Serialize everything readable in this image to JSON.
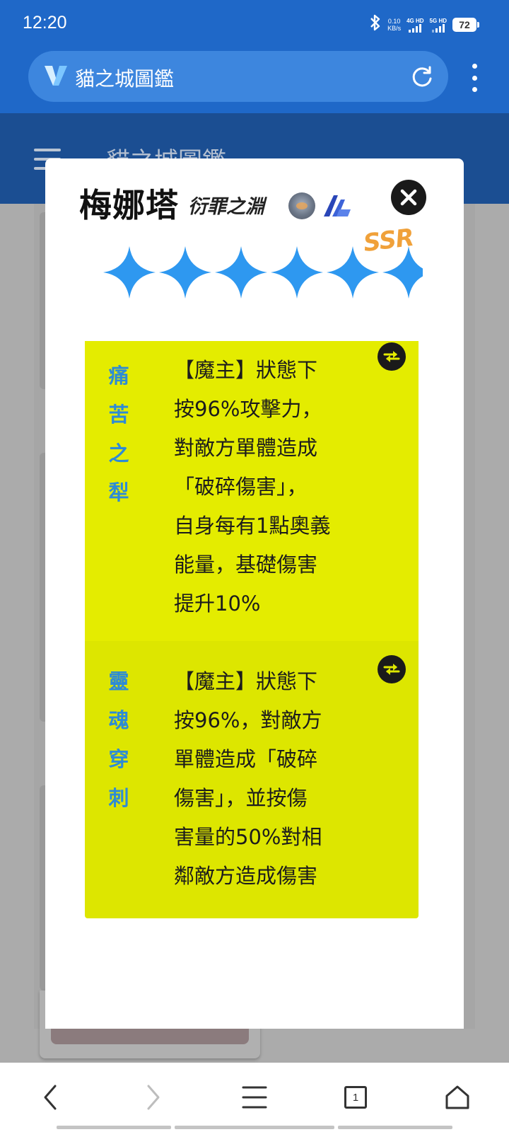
{
  "status_bar": {
    "time": "12:20",
    "net_speed_value": "0.10",
    "net_speed_unit": "KB/s",
    "sim1_label": "4G HD",
    "sim2_label": "5G HD",
    "battery": "72"
  },
  "browser": {
    "url_text": "貓之城圖鑑",
    "brand_color": "#1f68c8"
  },
  "background_page": {
    "title": "貓之城圖鑑"
  },
  "modal": {
    "name": "梅娜塔",
    "faction": "衍罪之淵",
    "rarity": "SSR",
    "star_count": 6,
    "skills": [
      {
        "name_chars": [
          "痛",
          "苦",
          "之",
          "犁"
        ],
        "lines": [
          "【魔主】狀態下",
          "按96%攻擊力，",
          "對敵方單體造成",
          "「破碎傷害」，",
          "自身每有1點奧義",
          "能量，基礎傷害",
          "提升10%"
        ]
      },
      {
        "name_chars": [
          "靈",
          "魂",
          "穿",
          "刺"
        ],
        "lines": [
          "【魔主】狀態下",
          "按96%，對敵方",
          "單體造成「破碎",
          "傷害」，並按傷",
          "害量的50%對相",
          "鄰敵方造成傷害"
        ]
      }
    ]
  },
  "bottom_nav": {
    "tab_count": "1"
  },
  "colors": {
    "skill_card_1": "#e4ec00",
    "skill_card_2": "#dde600",
    "skill_name": "#2d8bd6",
    "star": "#2e98f0",
    "rarity": "#f0a13a"
  }
}
